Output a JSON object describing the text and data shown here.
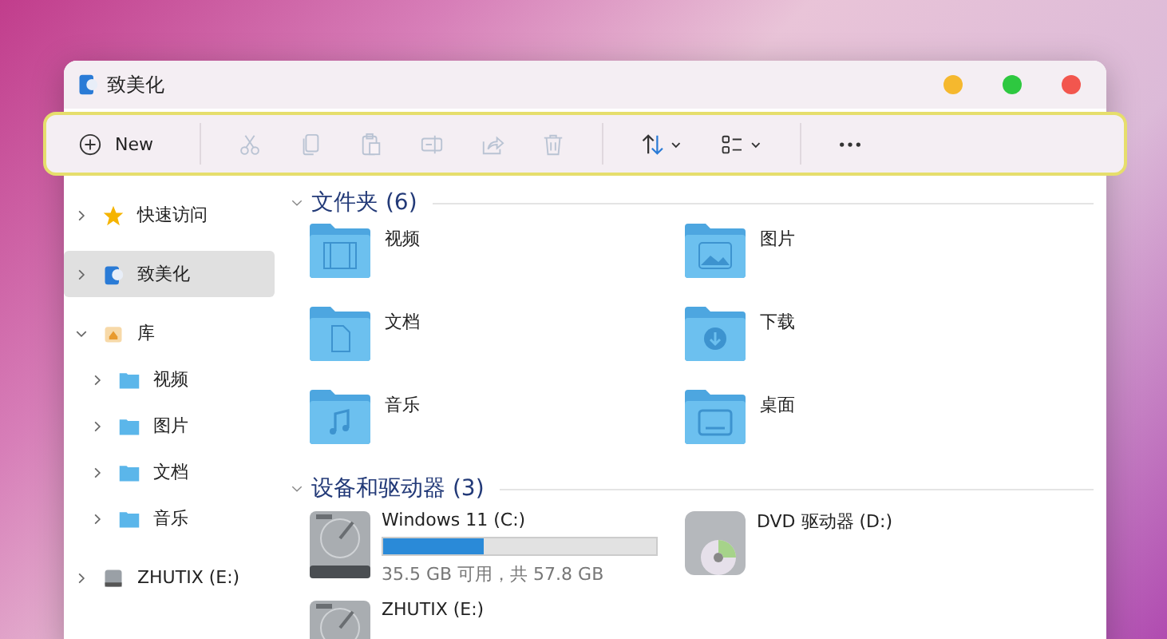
{
  "window": {
    "title": "致美化"
  },
  "toolbar": {
    "new_label": "New",
    "tools": [
      {
        "kind": "cut",
        "disabled": true
      },
      {
        "kind": "copy",
        "disabled": true
      },
      {
        "kind": "paste",
        "disabled": true
      },
      {
        "kind": "rename",
        "disabled": true
      },
      {
        "kind": "share",
        "disabled": true
      },
      {
        "kind": "delete",
        "disabled": true
      },
      {
        "kind": "sort",
        "disabled": false
      },
      {
        "kind": "view",
        "disabled": false
      },
      {
        "kind": "more",
        "disabled": false
      }
    ]
  },
  "sidebar": {
    "items": [
      {
        "label": "快速访问",
        "kind": "star",
        "expanded": false,
        "selected": false
      },
      {
        "label": "致美化",
        "kind": "user",
        "expanded": false,
        "selected": true
      },
      {
        "label": "库",
        "kind": "library",
        "expanded": true,
        "selected": false,
        "children": [
          {
            "label": "视频",
            "kind": "folder",
            "expanded": false,
            "selected": false
          },
          {
            "label": "图片",
            "kind": "folder",
            "expanded": false,
            "selected": false
          },
          {
            "label": "文档",
            "kind": "folder",
            "expanded": false,
            "selected": false
          },
          {
            "label": "音乐",
            "kind": "folder",
            "expanded": false,
            "selected": false
          }
        ]
      },
      {
        "label": "ZHUTIX (E:)",
        "kind": "drive",
        "expanded": false,
        "selected": false
      }
    ]
  },
  "folders": {
    "title": "文件夹 (6)",
    "expanded": true,
    "items": [
      {
        "name": "视频",
        "kind": "video"
      },
      {
        "name": "图片",
        "kind": "picture"
      },
      {
        "name": "文档",
        "kind": "document"
      },
      {
        "name": "下载",
        "kind": "download"
      },
      {
        "name": "音乐",
        "kind": "music"
      },
      {
        "name": "桌面",
        "kind": "desktop"
      }
    ]
  },
  "drives": {
    "title": "设备和驱动器 (3)",
    "expanded": true,
    "items": [
      {
        "name": "Windows 11 (C:)",
        "kind": "hdd",
        "level": 0.37,
        "space": "35.5 GB 可用，共 57.8 GB"
      },
      {
        "name": "DVD 驱动器 (D:)",
        "kind": "dvd"
      },
      {
        "name": "ZHUTIX (E:)",
        "kind": "hdd"
      }
    ]
  }
}
